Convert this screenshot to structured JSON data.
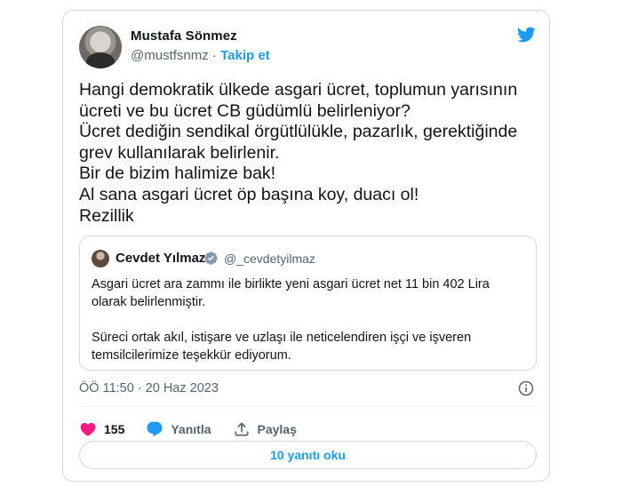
{
  "author": {
    "name": "Mustafa Sönmez",
    "handle": "@mustfsnmz",
    "separator": "·",
    "follow_label": "Takip et"
  },
  "tweet": {
    "lines": [
      "Hangi demokratik ülkede asgari ücret, toplumun yarısının",
      "ücreti ve bu ücret CB güdümlü belirleniyor?",
      "Ücret dediğin sendikal örgütlülükle, pazarlık, gerektiğinde",
      "grev kullanılarak belirlenir.",
      "Bir de bizim halimize bak!",
      "Al sana asgari ücret öp başına koy, duacı ol!",
      "Rezillik"
    ]
  },
  "quote": {
    "name": "Cevdet Yılmaz",
    "handle": "@_cevdetyilmaz",
    "paragraph1": "Asgari ücret ara zammı ile birlikte yeni asgari ücret net 11 bin 402 Lira\nolarak belirlenmiştir.",
    "paragraph2": "Süreci ortak akıl, istişare ve uzlaşı ile neticelendiren işçi ve işveren\ntemsilcilerimize teşekkür ediyorum."
  },
  "timestamp": "ÖÖ 11:50 · 20 Haz 2023",
  "actions": {
    "like_count": "155",
    "reply_label": "Yanıtla",
    "share_label": "Paylaş"
  },
  "replies_button": "10 yanıtı oku",
  "colors": {
    "accent": "#1d9bf0",
    "like": "#f91880",
    "muted": "#536471",
    "text": "#0f1419",
    "border": "#cfd9de"
  },
  "icons": [
    "twitter-bird-icon",
    "verified-icon",
    "info-icon",
    "heart-icon",
    "reply-icon",
    "share-icon"
  ]
}
